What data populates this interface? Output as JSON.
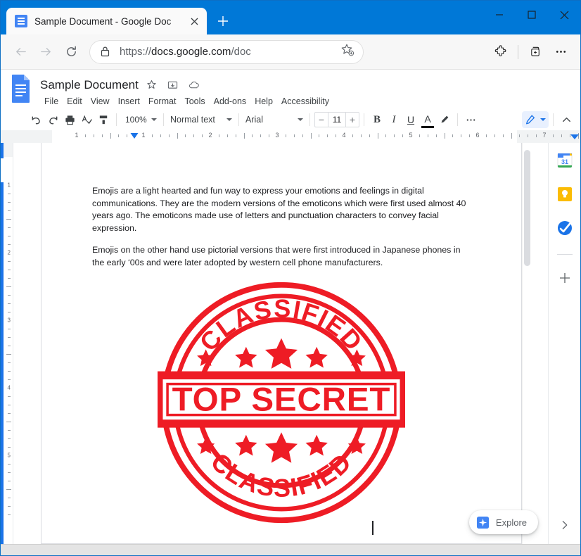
{
  "browser": {
    "tab": {
      "title": "Sample Document - Google Doc",
      "favicon_icon": "google-docs-favicon",
      "close_icon": "close-icon"
    },
    "new_tab_icon": "plus-icon",
    "window_controls": {
      "minimize_icon": "minimize-icon",
      "maximize_icon": "maximize-icon",
      "close_icon": "close-icon"
    },
    "toolbar": {
      "back_icon": "arrow-back-icon",
      "forward_icon": "arrow-forward-icon",
      "reload_icon": "reload-icon",
      "lock_icon": "lock-icon",
      "url": "https://docs.google.com/doc",
      "url_scheme": "https://",
      "url_host": "docs.google.com",
      "url_path": "/doc",
      "favorite_icon": "star-add-icon",
      "extensions_icon": "puzzle-piece-icon",
      "collections_icon": "collections-add-icon",
      "settings_icon": "ellipsis-icon"
    },
    "titlebar_color": "#0078d7"
  },
  "docs": {
    "logo_icon": "google-docs-logo",
    "title": "Sample Document",
    "title_icons": [
      {
        "name": "star-icon",
        "glyph": "☆"
      },
      {
        "name": "move-to-folder-icon",
        "glyph": "folder"
      },
      {
        "name": "cloud-saved-icon",
        "glyph": "cloud"
      }
    ],
    "menu": [
      {
        "label": "File"
      },
      {
        "label": "Edit"
      },
      {
        "label": "View"
      },
      {
        "label": "Insert"
      },
      {
        "label": "Format"
      },
      {
        "label": "Tools"
      },
      {
        "label": "Add-ons"
      },
      {
        "label": "Help"
      },
      {
        "label": "Accessibility"
      }
    ],
    "toolbar": {
      "undo_icon": "undo-icon",
      "redo_icon": "redo-icon",
      "print_icon": "print-icon",
      "spellcheck_icon": "spellcheck-icon",
      "paint_format_icon": "paint-format-icon",
      "zoom_value": "100%",
      "paragraph_style": "Normal text",
      "font_family": "Arial",
      "font_size_decrease": "−",
      "font_size": "11",
      "font_size_increase": "+",
      "bold_label": "B",
      "italic_label": "I",
      "underline_label": "U",
      "text_color_label": "A",
      "highlight_icon": "highlight-pen-icon",
      "more_icon": "ellipsis-icon",
      "edit_mode_icon": "pencil-icon",
      "collapse_icon": "chevron-up-icon"
    },
    "ruler": {
      "h_numbers": [
        "1",
        "1",
        "2",
        "3",
        "4",
        "5",
        "6",
        "7"
      ],
      "v_numbers": [
        "1",
        "2",
        "3",
        "4",
        "5"
      ],
      "left_indent_icon": "indent-marker-icon",
      "right_indent_icon": "indent-marker-icon"
    },
    "outline_icon": "document-outline-icon",
    "document": {
      "paragraphs": [
        "Emojis are a light hearted and fun way to express your emotions and feelings in digital communications. They are the modern versions of the emoticons which were first used almost 40 years ago. The emoticons made use of letters and punctuation characters to convey facial expression.",
        "Emojis on the other hand use pictorial versions that were first introduced in Japanese phones in the early ‘00s and were later adopted by western cell phone manufacturers."
      ],
      "stamp": {
        "banner_text": "TOP SECRET",
        "arc_text_top": "CLASSIFIED",
        "arc_text_bottom": "CLASSIFIED",
        "color": "#ee1c25",
        "star_count_top": 5,
        "star_count_bottom": 5
      },
      "text_caret": "text-cursor"
    },
    "explore": {
      "label": "Explore",
      "icon": "explore-star-icon"
    },
    "sidebar": {
      "items": [
        {
          "name": "google-calendar-icon",
          "label": "31"
        },
        {
          "name": "google-keep-icon",
          "label": ""
        },
        {
          "name": "google-tasks-icon",
          "label": ""
        }
      ],
      "add_icon": "plus-icon"
    },
    "scroll": {
      "vertical_thumb": "scrollbar-thumb",
      "expand_icon": "chevron-right-icon"
    }
  }
}
